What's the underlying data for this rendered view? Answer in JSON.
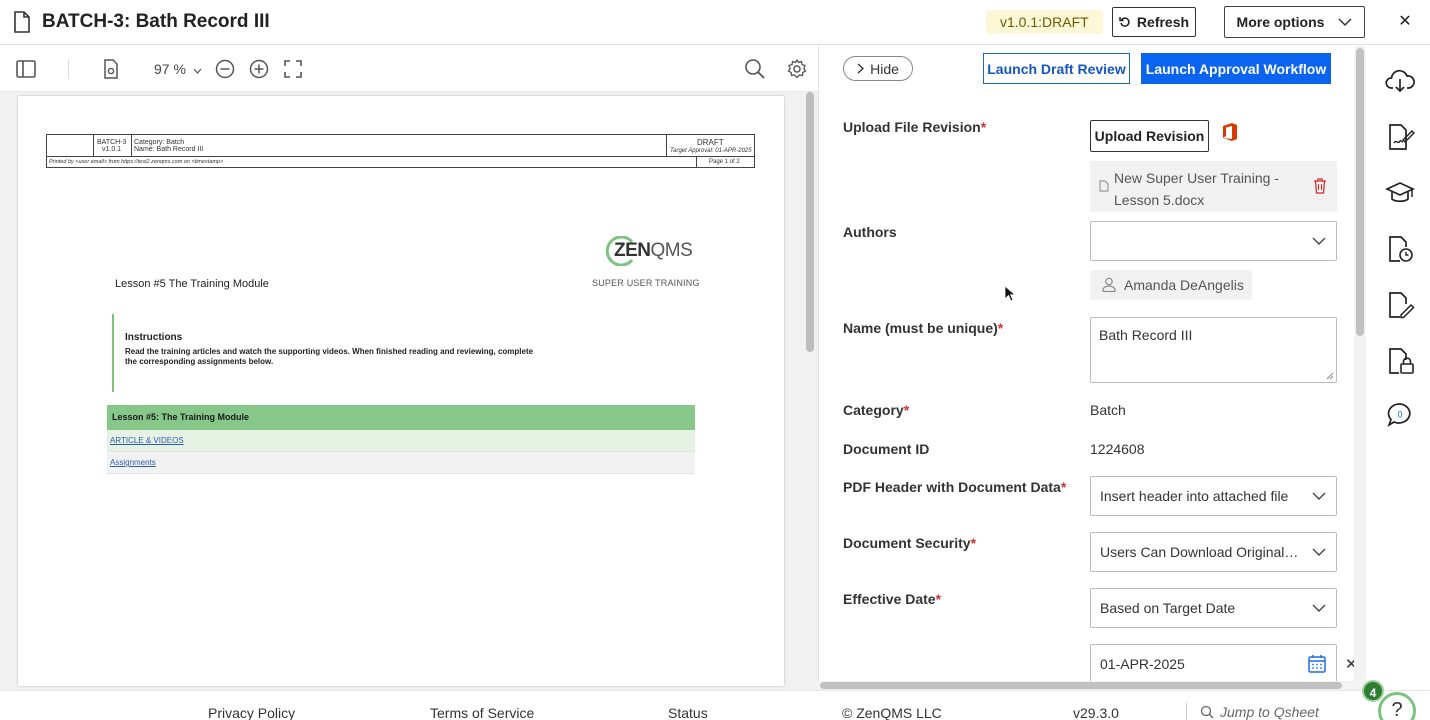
{
  "header": {
    "title": "BATCH-3: Bath Record III",
    "version_badge": "v1.0.1:DRAFT",
    "refresh_label": "Refresh",
    "more_options_label": "More options",
    "close_symbol": "✕"
  },
  "viewer_toolbar": {
    "zoom_label": "97 %",
    "icons": [
      "sidebar-toggle-icon",
      "page-settings-icon",
      "zoom-out-icon",
      "zoom-in-icon",
      "fullscreen-icon",
      "search-icon",
      "gear-icon"
    ]
  },
  "document": {
    "header_table": {
      "batch_id": "BATCH-3",
      "version": "v1.0.1",
      "category_line": "Category: Batch",
      "name_line": "Name: Bath Record III",
      "status": "DRAFT",
      "target_approval": "Target Approval: 01-APR-2025",
      "printed_by": "Printed by <user email> from https://test2.zenqms.com on <timestamp>",
      "page_of": "Page 1 of 2"
    },
    "logo_main": "ZEN",
    "logo_suffix": "QMS",
    "logo_sub": "SUPER USER TRAINING",
    "lesson_title": "Lesson #5 The Training Module",
    "instructions_title": "Instructions",
    "instructions_body": "Read the training articles and watch the supporting videos. When finished reading and reviewing, complete the corresponding assignments below.",
    "table_header": "Lesson #5: The Training Module",
    "table_rows": [
      "ARTICLE & VIDEOS",
      "Assignments"
    ]
  },
  "panel": {
    "hide_label": "Hide",
    "launch_draft_review_label": "Launch Draft Review",
    "launch_approval_label": "Launch Approval Workflow",
    "fields": {
      "upload_label": "Upload File Revision",
      "upload_button": "Upload Revision",
      "file_name": "New Super User Training - Lesson 5.docx",
      "authors_label": "Authors",
      "authors_value": "",
      "author_chip": "Amanda DeAngelis",
      "name_label": "Name (must be unique)",
      "name_value": "Bath Record III",
      "category_label": "Category",
      "category_value": "Batch",
      "docid_label": "Document ID",
      "docid_value": "1224608",
      "pdf_header_label": "PDF Header with Document Data",
      "pdf_header_value": "Insert header into attached file",
      "security_label": "Document Security",
      "security_value": "Users Can Download Original F...",
      "effective_label": "Effective Date",
      "effective_value": "Based on Target Date",
      "date_value": "01-APR-2025"
    },
    "required_mark": "*"
  },
  "rail": {
    "icons": [
      "cloud-download-icon",
      "sign-document-icon",
      "training-cap-icon",
      "document-history-icon",
      "edit-document-icon",
      "locked-document-icon",
      "comments-icon"
    ],
    "comment_count": "0"
  },
  "footer": {
    "privacy": "Privacy Policy",
    "terms": "Terms of Service",
    "status": "Status",
    "copyright": "© ZenQMS LLC",
    "version": "v29.3.0",
    "search_placeholder": "Jump to Qsheet",
    "help_badge_count": "4",
    "help_symbol": "?"
  },
  "colors": {
    "primary_blue": "#0a64f0",
    "required_red": "#d32f2f",
    "lesson_green": "#87c88a",
    "draft_badge_bg": "#fcf8d7",
    "office_red": "#d83b01"
  }
}
